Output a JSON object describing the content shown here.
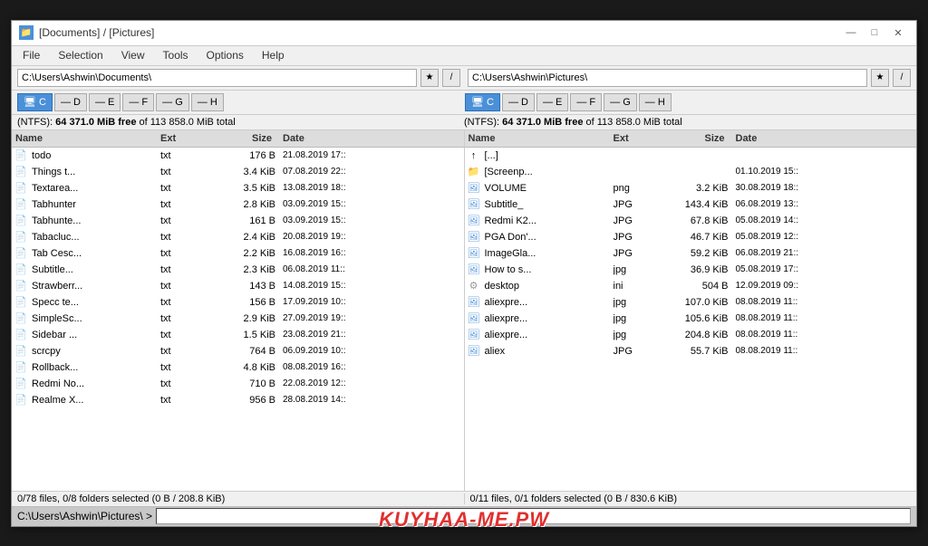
{
  "window": {
    "title": "[Documents] / [Pictures]",
    "icon": "📁"
  },
  "titleButtons": {
    "minimize": "—",
    "maximize": "□",
    "close": "✕"
  },
  "menuBar": {
    "items": [
      "File",
      "Selection",
      "View",
      "Tools",
      "Options",
      "Help"
    ]
  },
  "leftPanel": {
    "path": "C:\\Users\\Ashwin\\Documents\\",
    "drives": [
      "C",
      "D",
      "E",
      "F",
      "G",
      "H"
    ],
    "activeDrive": "C",
    "status": "(NTFS): 64 371.0 MiB free of 113 858.0 MiB total",
    "statusFree": "64 371.0 MiB free",
    "statusTotal": "of 113 858.0 MiB total",
    "columns": [
      "Name",
      "Ext",
      "Size",
      "Date"
    ],
    "files": [
      {
        "name": "todo",
        "ext": "txt",
        "size": "176 B",
        "date": "21.08.2019 17::",
        "icon": "txt"
      },
      {
        "name": "Things t...",
        "ext": "txt",
        "size": "3.4 KiB",
        "date": "07.08.2019 22::",
        "icon": "txt"
      },
      {
        "name": "Textarea...",
        "ext": "txt",
        "size": "3.5 KiB",
        "date": "13.08.2019 18::",
        "icon": "txt"
      },
      {
        "name": "Tabhunter",
        "ext": "txt",
        "size": "2.8 KiB",
        "date": "03.09.2019 15::",
        "icon": "txt"
      },
      {
        "name": "Tabhunte...",
        "ext": "txt",
        "size": "161 B",
        "date": "03.09.2019 15::",
        "icon": "txt"
      },
      {
        "name": "Tabacluc...",
        "ext": "txt",
        "size": "2.4 KiB",
        "date": "20.08.2019 19::",
        "icon": "txt"
      },
      {
        "name": "Tab Cesc...",
        "ext": "txt",
        "size": "2.2 KiB",
        "date": "16.08.2019 16::",
        "icon": "txt"
      },
      {
        "name": "Subtitle...",
        "ext": "txt",
        "size": "2.3 KiB",
        "date": "06.08.2019 11::",
        "icon": "txt"
      },
      {
        "name": "Strawberr...",
        "ext": "txt",
        "size": "143 B",
        "date": "14.08.2019 15::",
        "icon": "txt"
      },
      {
        "name": "Specc te...",
        "ext": "txt",
        "size": "156 B",
        "date": "17.09.2019 10::",
        "icon": "txt"
      },
      {
        "name": "SimpleSc...",
        "ext": "txt",
        "size": "2.9 KiB",
        "date": "27.09.2019 19::",
        "icon": "txt"
      },
      {
        "name": "Sidebar ...",
        "ext": "txt",
        "size": "1.5 KiB",
        "date": "23.08.2019 21::",
        "icon": "txt"
      },
      {
        "name": "scrcpy",
        "ext": "txt",
        "size": "764 B",
        "date": "06.09.2019 10::",
        "icon": "txt"
      },
      {
        "name": "Rollback...",
        "ext": "txt",
        "size": "4.8 KiB",
        "date": "08.08.2019 16::",
        "icon": "txt"
      },
      {
        "name": "Redmi No...",
        "ext": "txt",
        "size": "710 B",
        "date": "22.08.2019 12::",
        "icon": "txt"
      },
      {
        "name": "Realme X...",
        "ext": "txt",
        "size": "956 B",
        "date": "28.08.2019 14::",
        "icon": "txt"
      }
    ],
    "bottomStatus": "0/78 files, 0/8 folders selected (0 B / 208.8 KiB)"
  },
  "rightPanel": {
    "path": "C:\\Users\\Ashwin\\Pictures\\",
    "drives": [
      "C",
      "D",
      "E",
      "F",
      "G",
      "H"
    ],
    "activeDrive": "C",
    "status": "(NTFS): 64 371.0 MiB free of 113 858.0 MiB total",
    "statusFree": "64 371.0 MiB free",
    "statusTotal": "of 113 858.0 MiB total",
    "columns": [
      "Name",
      "Ext",
      "Size",
      "Date"
    ],
    "files": [
      {
        "name": "[...]",
        "ext": "",
        "size": "",
        "date": "",
        "icon": "parent"
      },
      {
        "name": "[Screenp...",
        "ext": "",
        "size": "",
        "date": "01.10.2019 15::",
        "icon": "folder"
      },
      {
        "name": "VOLUME",
        "ext": "png",
        "size": "3.2 KiB",
        "date": "30.08.2019 18::",
        "icon": "img"
      },
      {
        "name": "Subtitle_",
        "ext": "JPG",
        "size": "143.4 KiB",
        "date": "06.08.2019 13::",
        "icon": "img"
      },
      {
        "name": "Redmi K2...",
        "ext": "JPG",
        "size": "67.8 KiB",
        "date": "05.08.2019 14::",
        "icon": "img"
      },
      {
        "name": "PGA Don'...",
        "ext": "JPG",
        "size": "46.7 KiB",
        "date": "05.08.2019 12::",
        "icon": "img"
      },
      {
        "name": "ImageGla...",
        "ext": "JPG",
        "size": "59.2 KiB",
        "date": "06.08.2019 21::",
        "icon": "img"
      },
      {
        "name": "How to s...",
        "ext": "jpg",
        "size": "36.9 KiB",
        "date": "05.08.2019 17::",
        "icon": "img"
      },
      {
        "name": "desktop",
        "ext": "ini",
        "size": "504 B",
        "date": "12.09.2019 09::",
        "icon": "ini"
      },
      {
        "name": "aliexpre...",
        "ext": "jpg",
        "size": "107.0 KiB",
        "date": "08.08.2019 11::",
        "icon": "img"
      },
      {
        "name": "aliexpre...",
        "ext": "jpg",
        "size": "105.6 KiB",
        "date": "08.08.2019 11::",
        "icon": "img"
      },
      {
        "name": "aliexpre...",
        "ext": "jpg",
        "size": "204.8 KiB",
        "date": "08.08.2019 11::",
        "icon": "img"
      },
      {
        "name": "aliex",
        "ext": "JPG",
        "size": "55.7 KiB",
        "date": "08.08.2019 11::",
        "icon": "img"
      }
    ],
    "bottomStatus": "0/11 files, 0/1 folders selected (0 B / 830.6 KiB)"
  },
  "cmdBar": {
    "path": "C:\\Users\\Ashwin\\Pictures\\ >"
  },
  "watermark": "KUYHAA-ME.PW"
}
